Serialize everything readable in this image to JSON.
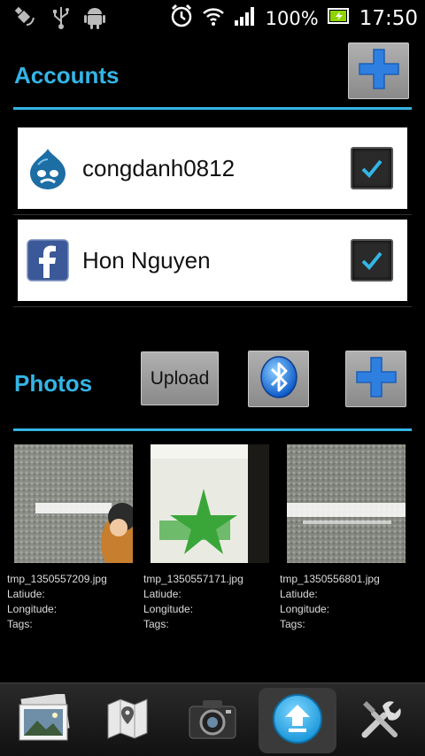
{
  "status_bar": {
    "battery": "100%",
    "time": "17:50",
    "icons": [
      "satellite-icon",
      "usb-icon",
      "android-icon",
      "alarm-icon",
      "wifi-icon",
      "signal-icon",
      "battery-icon"
    ]
  },
  "accounts": {
    "title": "Accounts",
    "items": [
      {
        "name": "congdanh0812",
        "service": "drupal-icon",
        "checked": true
      },
      {
        "name": "Hon Nguyen",
        "service": "facebook-icon",
        "checked": true
      }
    ]
  },
  "photos": {
    "title": "Photos",
    "upload_label": "Upload",
    "items": [
      {
        "filename": "tmp_1350557209.jpg",
        "latitude_label": "Latiude:",
        "longitude_label": "Longitude:",
        "tags_label": "Tags:"
      },
      {
        "filename": "tmp_1350557171.jpg",
        "latitude_label": "Latiude:",
        "longitude_label": "Longitude:",
        "tags_label": "Tags:"
      },
      {
        "filename": "tmp_1350556801.jpg",
        "latitude_label": "Latiude:",
        "longitude_label": "Longitude:",
        "tags_label": "Tags:"
      }
    ]
  },
  "bottom_bar": {
    "tabs": [
      "gallery-icon",
      "map-icon",
      "camera-icon",
      "upload-icon",
      "settings-icon"
    ],
    "active_tab": "upload-icon"
  },
  "colors": {
    "accent": "#33b5e5",
    "background": "#000000"
  }
}
